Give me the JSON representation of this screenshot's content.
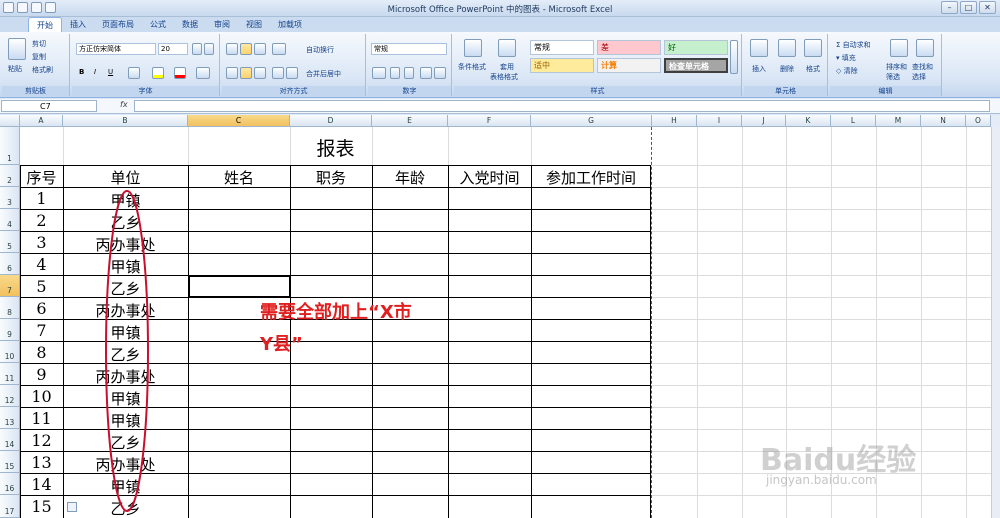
{
  "window": {
    "title": "Microsoft Office PowerPoint 中的图表 - Microsoft Excel"
  },
  "tabs": [
    "开始",
    "插入",
    "页面布局",
    "公式",
    "数据",
    "审阅",
    "视图",
    "加载项"
  ],
  "ribbon": {
    "clipboard": {
      "label": "剪贴板",
      "paste": "粘贴",
      "cut": "剪切",
      "copy": "复制",
      "format_painter": "格式刷"
    },
    "font": {
      "label": "字体",
      "name": "方正仿宋简体",
      "size": "20",
      "bold": "B",
      "italic": "I",
      "underline": "U"
    },
    "alignment": {
      "label": "对齐方式",
      "wrap": "自动换行",
      "merge": "合并后居中"
    },
    "number": {
      "label": "数字",
      "format": "常规"
    },
    "styles": {
      "label": "样式",
      "conditional": "条件格式",
      "table_format_1": "套用",
      "table_format_2": "表格格式",
      "cells": [
        {
          "text": "常规",
          "bg": "#ffffff",
          "color": "#000000"
        },
        {
          "text": "差",
          "bg": "#ffc7ce",
          "color": "#9c0006"
        },
        {
          "text": "好",
          "bg": "#c6efce",
          "color": "#006100"
        },
        {
          "text": "适中",
          "bg": "#ffeb9c",
          "color": "#9c6500"
        },
        {
          "text": "计算",
          "bg": "#f2f2f2",
          "color": "#fa7d00"
        },
        {
          "text": "检查单元格",
          "bg": "#a5a5a5",
          "color": "#ffffff"
        }
      ]
    },
    "cells": {
      "label": "单元格",
      "insert": "插入",
      "delete": "删除",
      "format": "格式"
    },
    "editing": {
      "label": "编辑",
      "autosum": "自动求和",
      "fill": "填充",
      "clear": "清除",
      "sort": "排序和",
      "sort2": "筛选",
      "find": "查找和",
      "find2": "选择"
    }
  },
  "formula": {
    "name_box": "C7",
    "fx": "fx",
    "value": ""
  },
  "columns": [
    "A",
    "B",
    "C",
    "D",
    "E",
    "F",
    "G",
    "H",
    "I",
    "J",
    "K",
    "L",
    "M",
    "N",
    "O"
  ],
  "rows": [
    "1",
    "2",
    "3",
    "4",
    "5",
    "6",
    "7",
    "8",
    "9",
    "10",
    "11",
    "12",
    "13",
    "14",
    "15",
    "16",
    "17"
  ],
  "sheet": {
    "title": "报表",
    "headers": [
      "序号",
      "单位",
      "姓名",
      "职务",
      "年龄",
      "入党时间",
      "参加工作时间"
    ],
    "data": [
      [
        "1",
        "甲镇"
      ],
      [
        "2",
        "乙乡"
      ],
      [
        "3",
        "丙办事处"
      ],
      [
        "4",
        "甲镇"
      ],
      [
        "5",
        "乙乡"
      ],
      [
        "6",
        "丙办事处"
      ],
      [
        "7",
        "甲镇"
      ],
      [
        "8",
        "乙乡"
      ],
      [
        "9",
        "丙办事处"
      ],
      [
        "10",
        "甲镇"
      ],
      [
        "11",
        "甲镇"
      ],
      [
        "12",
        "乙乡"
      ],
      [
        "13",
        "丙办事处"
      ],
      [
        "14",
        "甲镇"
      ],
      [
        "15",
        "乙乡"
      ]
    ],
    "annotation": [
      "需要全部加上“X市",
      "Y县”"
    ]
  },
  "watermark": {
    "brand": "Baidu经验",
    "url": "jingyan.baidu.com"
  }
}
